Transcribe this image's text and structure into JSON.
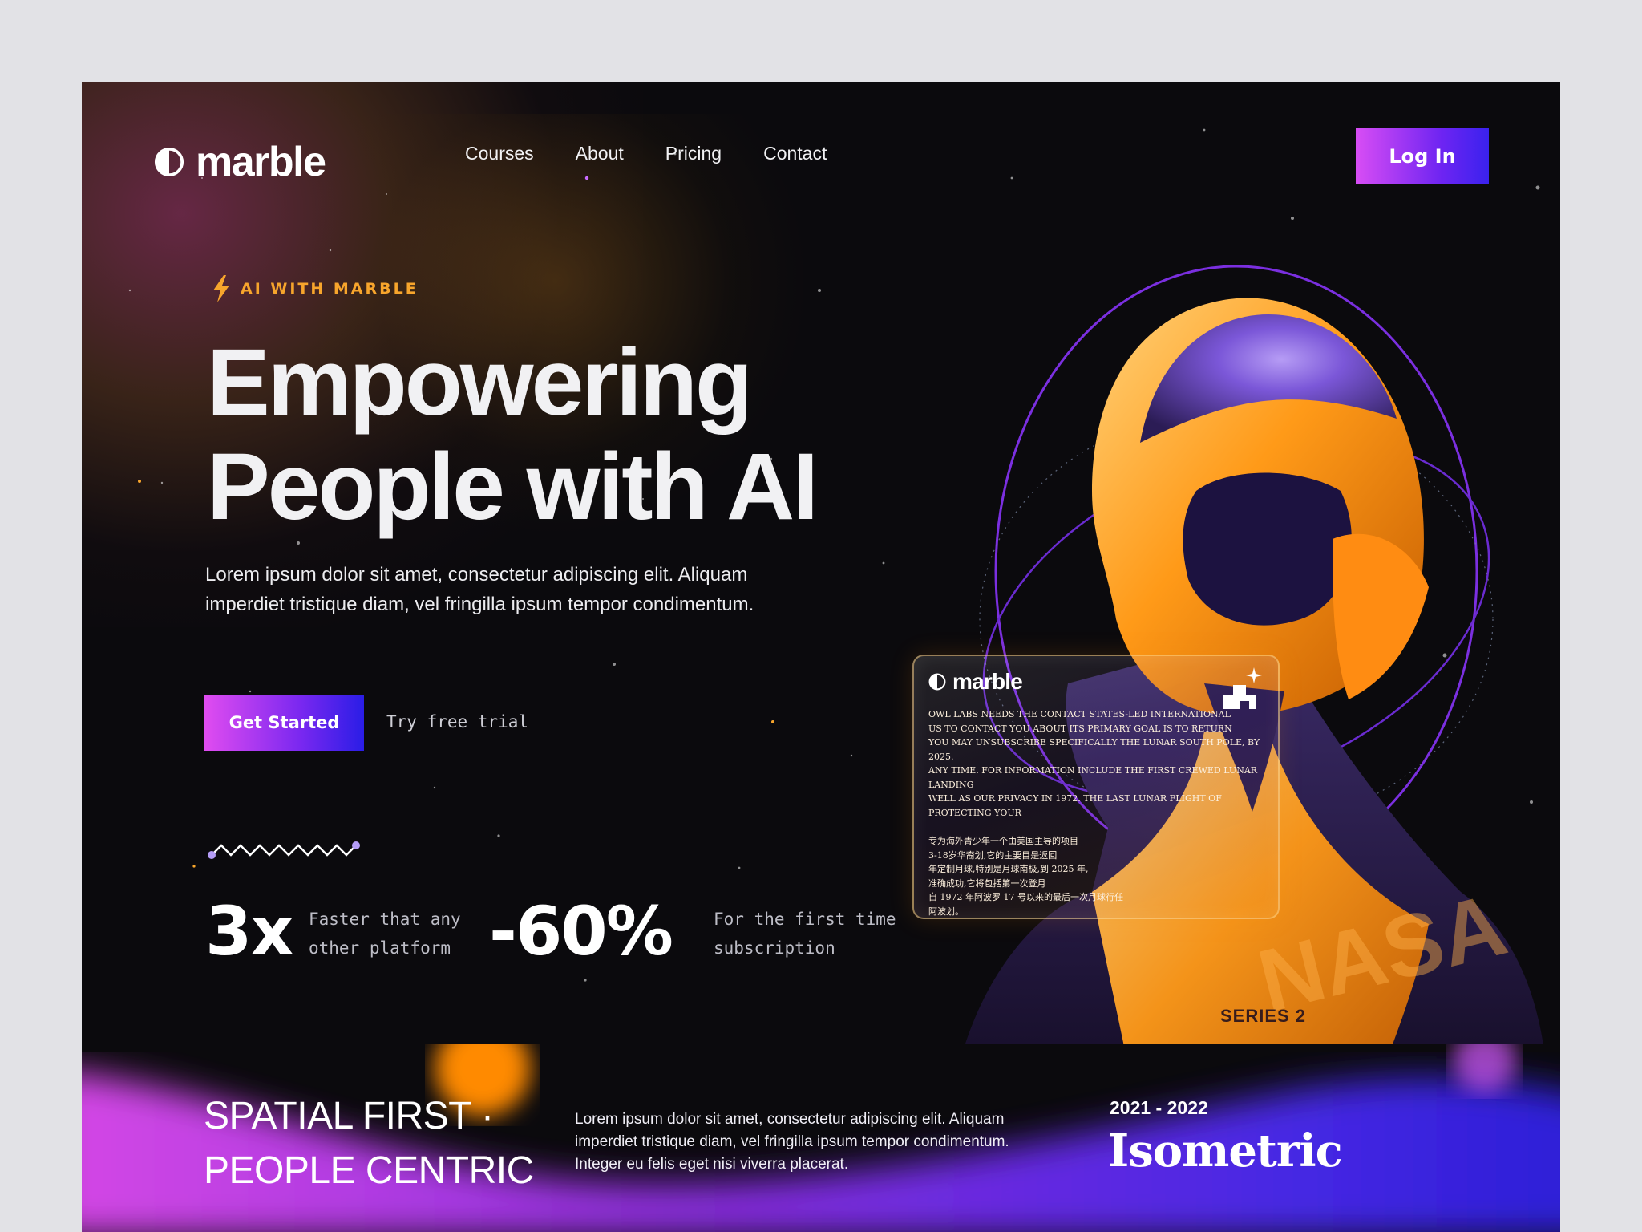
{
  "brand": {
    "name": "marble"
  },
  "nav": {
    "items": [
      "Courses",
      "About",
      "Pricing",
      "Contact"
    ],
    "login_label": "Log In"
  },
  "hero": {
    "eyebrow": "AI WITH MARBLE",
    "headline_line1": "Empowering",
    "headline_line2": "People with AI",
    "lede": "Lorem ipsum dolor sit amet, consectetur adipiscing elit. Aliquam imperdiet tristique diam, vel fringilla ipsum tempor condimentum.",
    "cta_label": "Get Started",
    "trial_label": "Try free trial"
  },
  "stats": [
    {
      "value": "3x",
      "line1": "Faster that any",
      "line2": "other platform"
    },
    {
      "value": "-60%",
      "line1": "For the first time",
      "line2": "subscription"
    }
  ],
  "card": {
    "logo": "marble",
    "body_lines": [
      "OWL LABS NEEDS THE CONTACT STATES-LED INTERNATIONAL",
      "US TO CONTACT YOU ABOUT ITS PRIMARY GOAL IS TO RETURN",
      "YOU MAY UNSUBSCRIBE SPECIFICALLY THE LUNAR SOUTH POLE, BY 2025.",
      "ANY TIME. FOR INFORMATION INCLUDE THE FIRST CREWED LUNAR LANDING",
      "WELL AS OUR PRIVACY IN 1972. THE LAST LUNAR FLIGHT OF",
      "PROTECTING YOUR"
    ],
    "cjk_lines": [
      "专为海外青少年一个由美国主导的项目",
      "3-18岁华裔划,它的主要目是返回",
      "年定制月球,特别是月球南极,到 2025 年,",
      "准确成功,它将包括第一次登月",
      "自 1972 年阿波罗 17 号以来的最后一次月球行任",
      "阿波划。"
    ],
    "series_text": "SERIES 2"
  },
  "band": {
    "title_line1": "SPATIAL FIRST ·",
    "title_line2": "PEOPLE CENTRIC",
    "description": "Lorem ipsum dolor sit amet, consectetur adipiscing elit. Aliquam imperdiet tristique diam, vel fringilla ipsum tempor condimentum. Integer eu felis eget nisi viverra placerat.",
    "years": "2021 - 2022",
    "word": "Isometric"
  },
  "colors": {
    "accent_orange": "#f7a52c",
    "accent_purple": "#7a28f0",
    "accent_pink": "#e04cf0",
    "accent_blue": "#2a1de6"
  }
}
